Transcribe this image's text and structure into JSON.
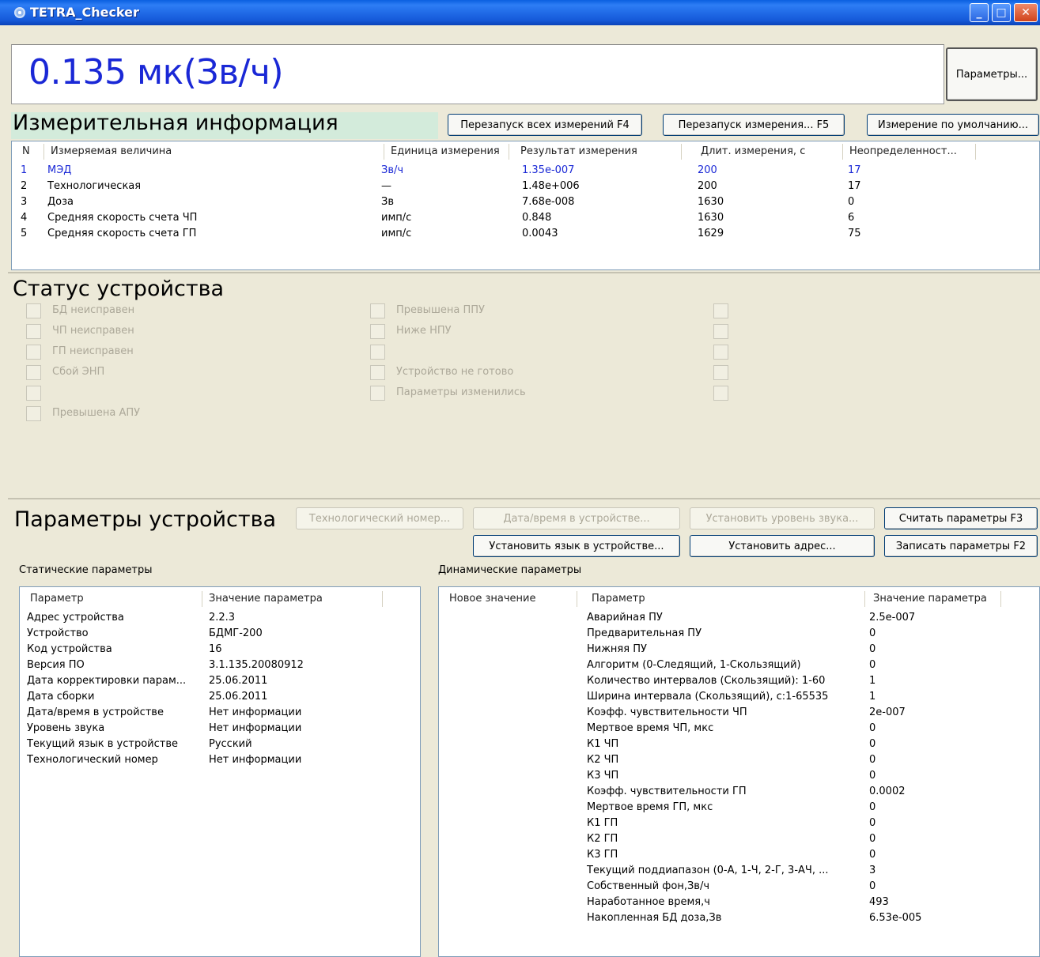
{
  "window": {
    "title": "TETRA_Checker",
    "min_label": "_",
    "max_label": "□",
    "close_label": "✕"
  },
  "top": {
    "value": "0.135 мк(Зв/ч)",
    "params_button": "Параметры..."
  },
  "measurement": {
    "title": "Измерительная информация",
    "buttons": [
      "Перезапуск всех измерений F4",
      "Перезапуск измерения... F5",
      "Измерение по умолчанию..."
    ],
    "columns": [
      "N",
      "Измеряемая величина",
      "Единица измерения",
      "Результат измерения",
      "Длит. измерения, с",
      "Неопределенност..."
    ],
    "rows": [
      [
        "1",
        "МЭД",
        "Зв/ч",
        "1.35e-007",
        "200",
        "17"
      ],
      [
        "2",
        "Технологическая",
        "—",
        "1.48e+006",
        "200",
        "17"
      ],
      [
        "3",
        "Доза",
        "Зв",
        "7.68e-008",
        "1630",
        "0"
      ],
      [
        "4",
        "Средняя скорость счета ЧП",
        "имп/с",
        "0.848",
        "1630",
        "6"
      ],
      [
        "5",
        "Средняя скорость счета ГП",
        "имп/с",
        "0.0043",
        "1629",
        "75"
      ]
    ]
  },
  "status": {
    "title": "Статус устройства",
    "col1": [
      "БД неисправен",
      "ЧП неисправен",
      "ГП неисправен",
      "Сбой ЭНП",
      "",
      "Превышена АПУ"
    ],
    "col2": [
      "Превышена ППУ",
      "Ниже НПУ",
      "",
      "Устройство не готово",
      "Параметры изменились"
    ],
    "col3_count": 5
  },
  "device": {
    "title": "Параметры устройства",
    "buttons_row1": [
      "Технологический номер...",
      "Дата/время в устройстве...",
      "Установить уровень звука...",
      "Считать параметры F3"
    ],
    "buttons_row2": [
      "Установить язык в устройстве...",
      "Установить адрес...",
      "Записать параметры F2"
    ],
    "static_label": "Статические параметры",
    "dynamic_label": "Динамические параметры",
    "static_columns": [
      "Параметр",
      "Значение параметра"
    ],
    "static_rows": [
      [
        "Адрес устройства",
        "2.2.3"
      ],
      [
        "Устройство",
        "БДМГ-200"
      ],
      [
        "Код устройства",
        "16"
      ],
      [
        "Версия ПО",
        "3.1.135.20080912"
      ],
      [
        "Дата корректировки парам...",
        "25.06.2011"
      ],
      [
        "Дата сборки",
        "25.06.2011"
      ],
      [
        "Дата/время в устройстве",
        "Нет информации"
      ],
      [
        "Уровень звука",
        "Нет информации"
      ],
      [
        "Текущий язык в устройстве",
        "Русский"
      ],
      [
        "Технологический номер",
        "Нет информации"
      ]
    ],
    "dynamic_columns": [
      "Новое значение",
      "Параметр",
      "Значение параметра"
    ],
    "dynamic_rows": [
      [
        "Аварийная ПУ",
        "2.5e-007"
      ],
      [
        "Предварительная ПУ",
        "0"
      ],
      [
        "Нижняя ПУ",
        "0"
      ],
      [
        "Алгоритм (0-Следящий, 1-Скользящий)",
        "0"
      ],
      [
        "Количество интервалов (Скользящий): 1-60",
        "1"
      ],
      [
        "Ширина интервала (Скользящий), с:1-65535",
        "1"
      ],
      [
        "Коэфф. чувствительности ЧП",
        "2e-007"
      ],
      [
        "Мертвое время ЧП, мкс",
        "0"
      ],
      [
        "К1 ЧП",
        "0"
      ],
      [
        "К2 ЧП",
        "0"
      ],
      [
        "К3 ЧП",
        "0"
      ],
      [
        "Коэфф. чувствительности ГП",
        "0.0002"
      ],
      [
        "Мертвое время ГП, мкс",
        "0"
      ],
      [
        "К1 ГП",
        "0"
      ],
      [
        "К2 ГП",
        "0"
      ],
      [
        "К3 ГП",
        "0"
      ],
      [
        "Текущий поддиапазон (0-А, 1-Ч, 2-Г, 3-АЧ, ...",
        "3"
      ],
      [
        "Собственный фон,Зв/ч",
        "0"
      ],
      [
        "Наработанное время,ч",
        "493"
      ],
      [
        "Накопленная БД доза,Зв",
        "6.53e-005"
      ]
    ]
  }
}
